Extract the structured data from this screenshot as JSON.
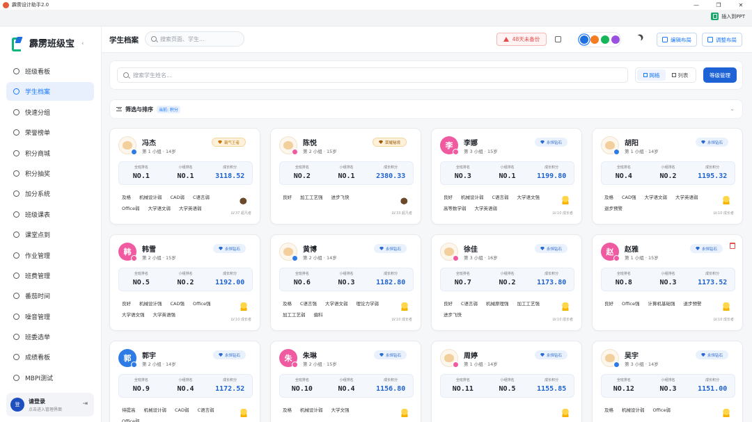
{
  "window": {
    "title": "霹雳设计助手2.0",
    "controls": [
      "—",
      "❐",
      "✕"
    ]
  },
  "plugin": {
    "insert_label": "插入到PPT"
  },
  "sidebar": {
    "brand": "霹雳班级宝",
    "collapse": "‹",
    "items": [
      {
        "label": "班级看板",
        "icon": "dashboard-icon"
      },
      {
        "label": "学生档案",
        "icon": "students-icon",
        "active": true
      },
      {
        "label": "快速分组",
        "icon": "group-icon"
      },
      {
        "label": "荣誉榜单",
        "icon": "trophy-icon"
      },
      {
        "label": "积分商城",
        "icon": "shop-icon"
      },
      {
        "label": "积分抽奖",
        "icon": "gift-icon"
      },
      {
        "label": "加分系统",
        "icon": "plus-icon"
      },
      {
        "label": "班级课表",
        "icon": "calendar-icon"
      },
      {
        "label": "课堂点到",
        "icon": "checkin-icon"
      },
      {
        "label": "作业管理",
        "icon": "homework-icon"
      },
      {
        "label": "班费管理",
        "icon": "wallet-icon"
      },
      {
        "label": "番茄时间",
        "icon": "timer-icon"
      },
      {
        "label": "噪音管理",
        "icon": "sound-icon"
      },
      {
        "label": "班委选举",
        "icon": "vote-icon"
      },
      {
        "label": "成绩看板",
        "icon": "grades-icon"
      },
      {
        "label": "MBPI测试",
        "icon": "test-icon"
      }
    ],
    "login": {
      "avatar": "登",
      "title": "请登录",
      "subtitle": "点击进入管理界面"
    }
  },
  "topbar": {
    "title": "学生档案",
    "search_placeholder": "搜索页面、学生...",
    "backup_warning": "48天未备份",
    "theme_colors": [
      "#1e6fe0",
      "#f57c1f",
      "#18b65a",
      "#9b51e0"
    ],
    "edit_layout": "编辑布局",
    "adjust_layout": "调整布局"
  },
  "main": {
    "student_search_placeholder": "搜索学生姓名...",
    "view_grid": "网格",
    "view_list": "列表",
    "rating_button": "等级管理",
    "filter_label": "筛选与排序",
    "filter_tag": "当前: 积分",
    "stat_labels": [
      "全班排名",
      "小组排名",
      "成长积分"
    ]
  },
  "students": [
    {
      "name": "冯杰",
      "meta": "第 1 小组 · 14岁",
      "avatar": "",
      "avatar_color": "",
      "sex": "male",
      "badge": "霸气王者",
      "badge_type": "gold",
      "class_rank": "NO.1",
      "group_rank": "NO.1",
      "points": "3118.52",
      "tags": [
        "及格",
        "机械设计弱",
        "CAD弱",
        "C语言弱",
        "Office弱",
        "大学语文弱",
        "大学英语弱"
      ],
      "mascot": "bird",
      "level": "LV.37 超凡者"
    },
    {
      "name": "陈悦",
      "meta": "第 2 小组 · 15岁",
      "avatar": "",
      "avatar_color": "",
      "sex": "female",
      "badge": "荣耀秘境",
      "badge_type": "dark",
      "class_rank": "NO.2",
      "group_rank": "NO.1",
      "points": "2380.33",
      "tags": [
        "良好",
        "加工工艺强",
        "进步飞快"
      ],
      "mascot": "bird",
      "level": "LV.33 超凡者"
    },
    {
      "name": "李娜",
      "meta": "第 3 小组 · 15岁",
      "avatar": "李",
      "avatar_color": "#ef5aa0",
      "sex": "female",
      "badge": "永恒钻石",
      "badge_type": "diamond",
      "class_rank": "NO.3",
      "group_rank": "NO.1",
      "points": "1199.80",
      "tags": [
        "良好",
        "机械设计弱",
        "C语言弱",
        "大学语文强",
        "高等数学弱",
        "大学英语弱"
      ],
      "mascot": "duck",
      "level": "LV.10 成长者"
    },
    {
      "name": "胡阳",
      "meta": "第 1 小组 · 14岁",
      "avatar": "",
      "avatar_color": "",
      "sex": "male",
      "badge": "永恒钻石",
      "badge_type": "diamond",
      "class_rank": "NO.4",
      "group_rank": "NO.2",
      "points": "1195.32",
      "tags": [
        "及格",
        "CAD强",
        "大学语文弱",
        "大学英语弱",
        "退步预警"
      ],
      "mascot": "duck",
      "level": "LV.10 成长者"
    },
    {
      "name": "韩雪",
      "meta": "第 2 小组 · 15岁",
      "avatar": "韩",
      "avatar_color": "#ef5aa0",
      "sex": "female",
      "badge": "永恒钻石",
      "badge_type": "diamond",
      "class_rank": "NO.5",
      "group_rank": "NO.2",
      "points": "1192.00",
      "tags": [
        "良好",
        "机械设计强",
        "CAD强",
        "Office强",
        "大学语文强",
        "大学英语强"
      ],
      "mascot": "duck",
      "level": "LV.10 成长者"
    },
    {
      "name": "黄博",
      "meta": "第 2 小组 · 14岁",
      "avatar": "",
      "avatar_color": "",
      "sex": "male",
      "badge": "永恒钻石",
      "badge_type": "diamond",
      "class_rank": "NO.6",
      "group_rank": "NO.3",
      "points": "1182.80",
      "tags": [
        "及格",
        "C语言强",
        "大学语文弱",
        "理论力学弱",
        "加工工艺弱",
        "偏科"
      ],
      "mascot": "duck",
      "level": "LV.10 成长者"
    },
    {
      "name": "徐佳",
      "meta": "第 3 小组 · 16岁",
      "avatar": "",
      "avatar_color": "",
      "sex": "female",
      "badge": "永恒钻石",
      "badge_type": "diamond",
      "class_rank": "NO.7",
      "group_rank": "NO.2",
      "points": "1173.80",
      "tags": [
        "良好",
        "C语言弱",
        "机械原理强",
        "加工工艺强",
        "进步飞快"
      ],
      "mascot": "duck",
      "level": "LV.10 成长者"
    },
    {
      "name": "赵雅",
      "meta": "第 1 小组 · 15岁",
      "avatar": "赵",
      "avatar_color": "#ef5aa0",
      "sex": "female",
      "badge": "永恒钻石",
      "badge_type": "diamond",
      "class_rank": "NO.8",
      "group_rank": "NO.3",
      "points": "1173.52",
      "tags": [
        "良好",
        "Office强",
        "计算机基础强",
        "退步预警"
      ],
      "mascot": "duck",
      "level": "LV.10 成长者",
      "deletable": true
    },
    {
      "name": "郭宇",
      "meta": "第 2 小组 · 14岁",
      "avatar": "郭",
      "avatar_color": "#2f7be5",
      "sex": "male",
      "badge": "永恒钻石",
      "badge_type": "diamond",
      "class_rank": "NO.9",
      "group_rank": "NO.4",
      "points": "1172.52",
      "tags": [
        "待提高",
        "机械设计弱",
        "CAD弱",
        "C语言弱",
        "Office弱"
      ],
      "mascot": "duck",
      "level": ""
    },
    {
      "name": "朱琳",
      "meta": "第 2 小组 · 15岁",
      "avatar": "朱",
      "avatar_color": "#ef5aa0",
      "sex": "female",
      "badge": "永恒钻石",
      "badge_type": "diamond",
      "class_rank": "NO.10",
      "group_rank": "NO.4",
      "points": "1156.80",
      "tags": [
        "及格",
        "机械设计弱",
        "大学文强"
      ],
      "mascot": "duck",
      "level": ""
    },
    {
      "name": "周婷",
      "meta": "第 1 小组 · 14岁",
      "avatar": "",
      "avatar_color": "",
      "sex": "female",
      "badge": "永恒钻石",
      "badge_type": "diamond",
      "class_rank": "NO.11",
      "group_rank": "NO.5",
      "points": "1155.85",
      "tags": [],
      "mascot": "duck",
      "level": ""
    },
    {
      "name": "吴宇",
      "meta": "第 3 小组 · 14岁",
      "avatar": "",
      "avatar_color": "",
      "sex": "male",
      "badge": "永恒钻石",
      "badge_type": "diamond",
      "class_rank": "NO.12",
      "group_rank": "NO.3",
      "points": "1151.00",
      "tags": [
        "及格",
        "机械设计弱",
        "Office弱"
      ],
      "mascot": "duck",
      "level": ""
    }
  ]
}
